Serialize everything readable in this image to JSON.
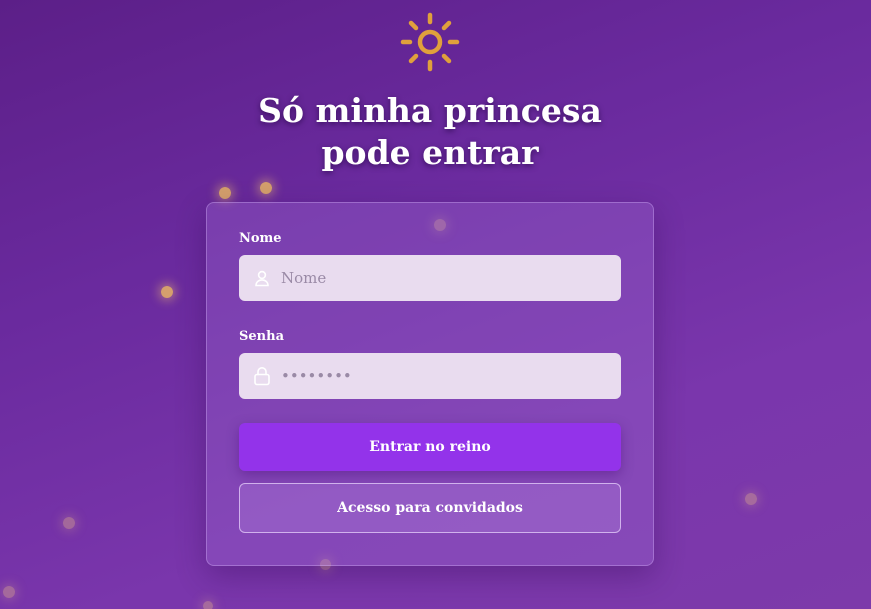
{
  "title": "Só minha princesa pode entrar",
  "form": {
    "name_label": "Nome",
    "name_placeholder": "Nome",
    "name_value": "",
    "password_label": "Senha",
    "password_placeholder": "••••••••",
    "password_value": "",
    "login_button": "Entrar no reino",
    "guest_button": "Acesso para convidados"
  },
  "icons": {
    "logo": "sun-icon",
    "name_field": "user-icon",
    "password_field": "lock-icon"
  },
  "colors": {
    "background": "#6a2a9e",
    "sun": "#e0a03c",
    "primary_button": "#9333ea",
    "input_background": "#e9dcef"
  }
}
